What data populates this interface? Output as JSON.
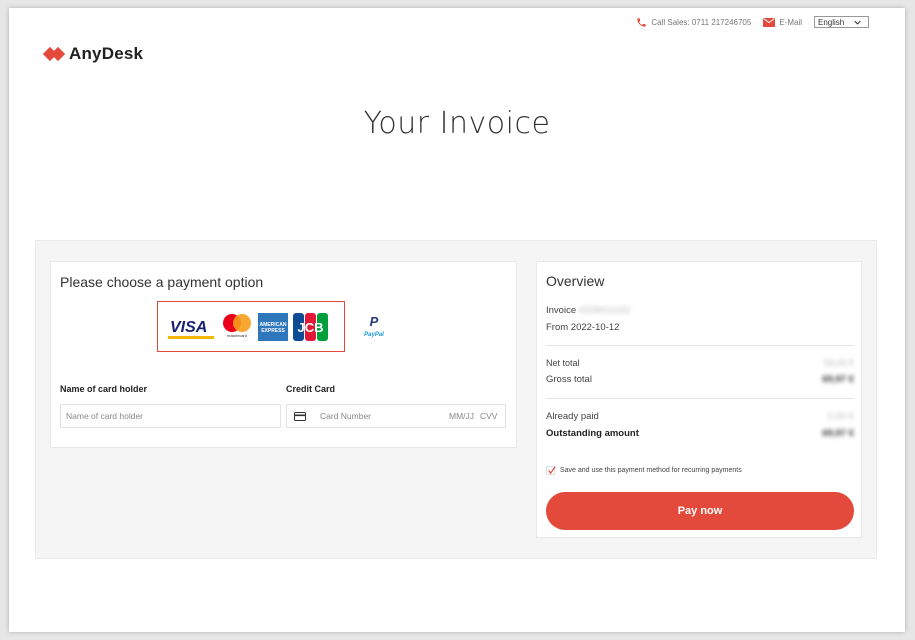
{
  "topbar": {
    "call_sales_label": "Call Sales:",
    "phone": "0711 217246705",
    "email_label": "E-Mail",
    "language": "English"
  },
  "brand": {
    "name": "AnyDesk",
    "color": "#e34a3c"
  },
  "page_title": "Your Invoice",
  "payment": {
    "heading": "Please choose a payment option",
    "methods": [
      "VISA",
      "mastercard",
      "AMERICAN EXPRESS",
      "JCB",
      "PayPal"
    ],
    "card_holder_label": "Name of card holder",
    "card_holder_placeholder": "Name of card holder",
    "credit_card_label": "Credit Card",
    "card_number_placeholder": "Card Number",
    "expiry_placeholder": "MM/JJ",
    "cvv_placeholder": "CVV"
  },
  "overview": {
    "heading": "Overview",
    "invoice_label": "Invoice",
    "invoice_number": "4328411162",
    "from_text": "From 2022-10-12",
    "net_total_label": "Net total",
    "net_total_value": "59,00 €",
    "gross_total_label": "Gross total",
    "gross_total_value": "69,97 €",
    "already_paid_label": "Already paid",
    "already_paid_value": "0,00 €",
    "outstanding_label": "Outstanding amount",
    "outstanding_value": "69,97 €",
    "save_method_text": "Save and use this payment method for recurring payments",
    "pay_button": "Pay now"
  }
}
